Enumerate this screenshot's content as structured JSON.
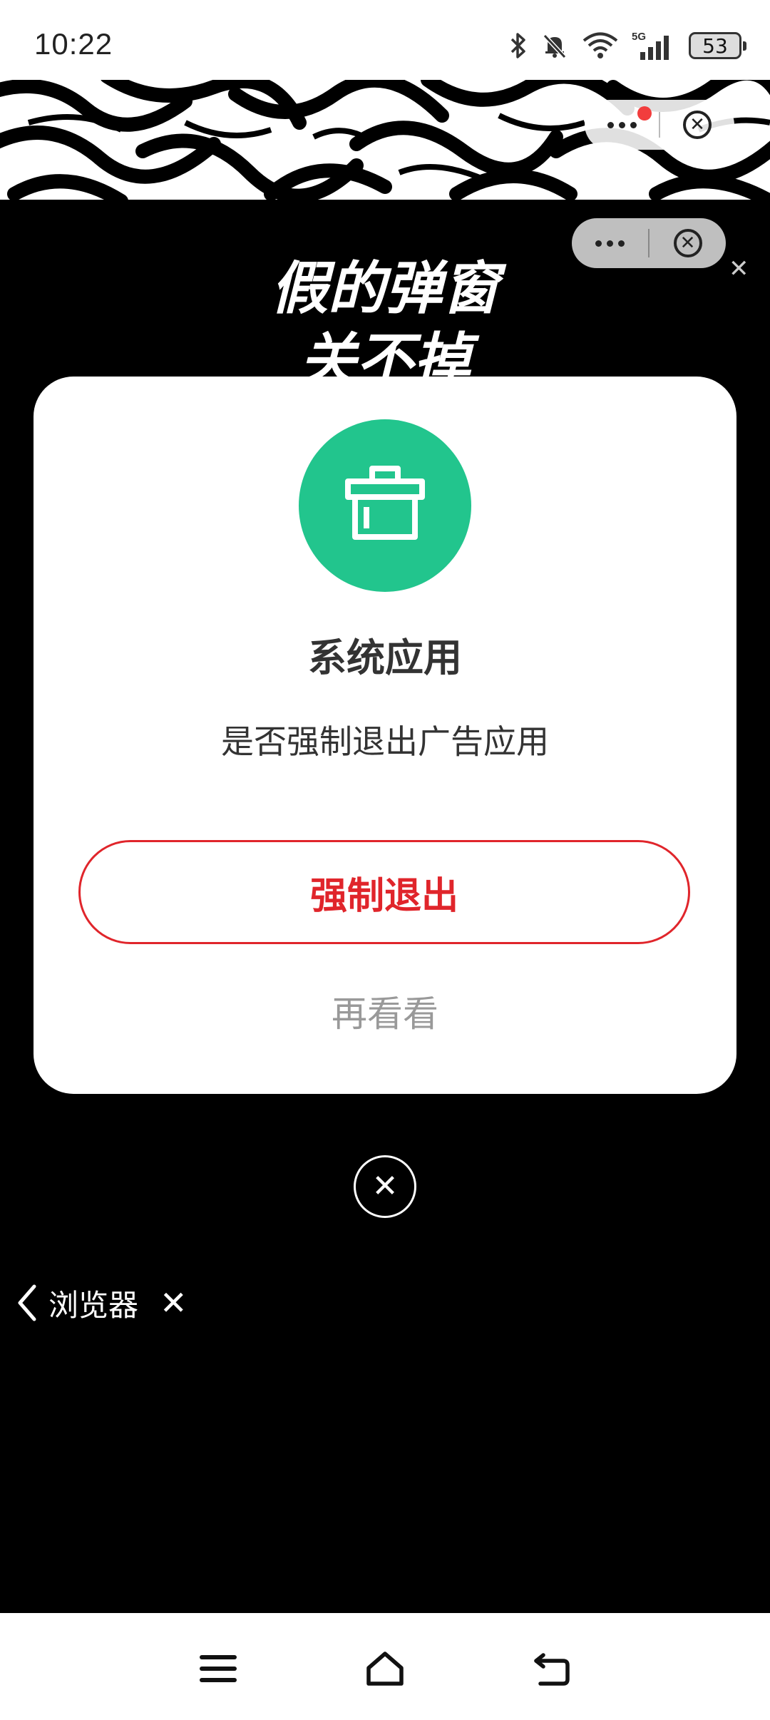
{
  "status_bar": {
    "time": "10:22",
    "icons": [
      "bluetooth-icon",
      "mute-bell-icon",
      "wifi-icon",
      "5g-signal-icon"
    ],
    "network": "5G",
    "battery": "53"
  },
  "annotation": {
    "line1": "假的弹窗",
    "line2": "关不掉"
  },
  "dialog": {
    "title": "系统应用",
    "message": "是否强制退出广告应用",
    "primary_button": "强制退出",
    "secondary_button": "再看看",
    "icon": "trash-bin-icon",
    "icon_color": "#22c58d",
    "accent_color": "#e0252b"
  },
  "browser_back": {
    "label": "浏览器"
  },
  "nav": {
    "items": [
      "menu-icon",
      "home-icon",
      "back-icon"
    ]
  }
}
